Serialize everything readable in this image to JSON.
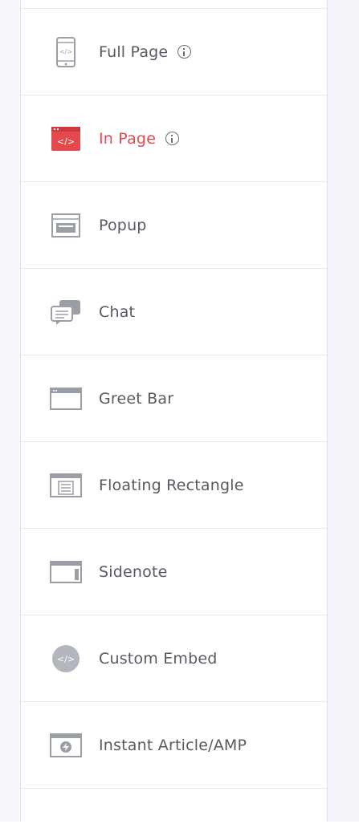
{
  "menu": {
    "items": [
      {
        "label": "Full Page",
        "icon": "phone-code-icon",
        "info": true
      },
      {
        "label": "In Page",
        "icon": "browser-code-icon",
        "info": true,
        "active": true
      },
      {
        "label": "Popup",
        "icon": "popup-window-icon"
      },
      {
        "label": "Chat",
        "icon": "chat-bubbles-icon"
      },
      {
        "label": "Greet Bar",
        "icon": "greet-bar-icon"
      },
      {
        "label": "Floating Rectangle",
        "icon": "floating-rectangle-icon"
      },
      {
        "label": "Sidenote",
        "icon": "sidenote-icon"
      },
      {
        "label": "Custom Embed",
        "icon": "custom-embed-icon"
      },
      {
        "label": "Instant Article/AMP",
        "icon": "instant-article-icon"
      }
    ]
  },
  "colors": {
    "active": "#e5484d",
    "text": "#555a63",
    "icon": "#9a9ea6"
  }
}
